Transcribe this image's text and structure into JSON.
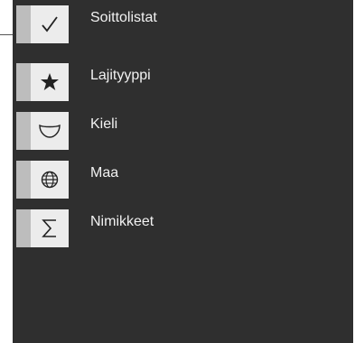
{
  "menu": {
    "items": [
      {
        "label": "Soittolistat",
        "icon": "checkmark-icon"
      },
      {
        "label": "Lajityyppi",
        "icon": "star-icon"
      },
      {
        "label": "Kieli",
        "icon": "speech-bubble-icon"
      },
      {
        "label": "Maa",
        "icon": "globe-icon"
      },
      {
        "label": "Nimikkeet",
        "icon": "sigma-icon"
      }
    ]
  },
  "colors": {
    "panel_background": "#2f2f2f",
    "tile_background": "#ececec",
    "tile_accent_bar": "#bdbdbd",
    "label_text": "#f2f2f2"
  }
}
